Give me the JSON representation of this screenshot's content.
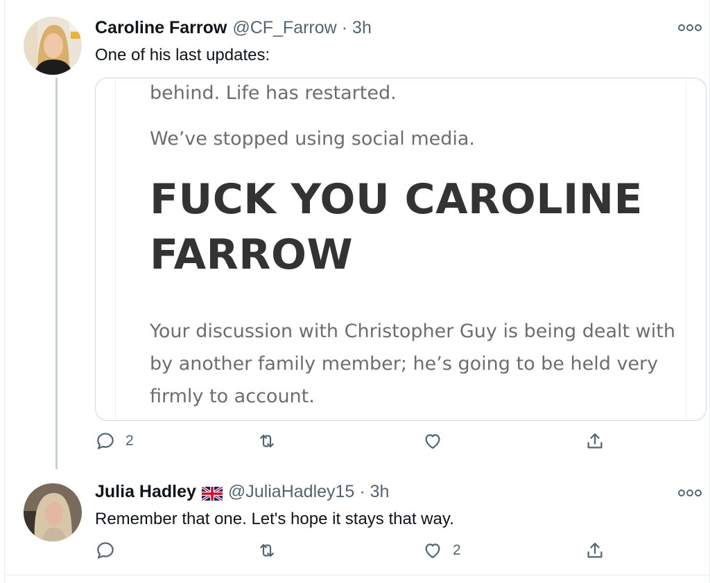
{
  "tweets": [
    {
      "author_name": "Caroline Farrow",
      "handle": "@CF_Farrow",
      "time": "3h",
      "text": "One of his last updates:",
      "media": {
        "line1": "behind. Life has restarted.",
        "line2": "We’ve stopped using social media.",
        "heading_line1": "FUCK YOU CAROLINE",
        "heading_line2": "FARROW",
        "paragraph": "Your discussion with Christopher Guy is being dealt with by another family member; he’s going to be held very firmly to account."
      },
      "reply_count": "2",
      "retweet_count": "",
      "like_count": ""
    },
    {
      "author_name": "Julia Hadley",
      "handle": "@JuliaHadley15",
      "time": "3h",
      "text": "Remember that one. Let's hope it stays that way.",
      "reply_count": "",
      "retweet_count": "",
      "like_count": "2"
    }
  ],
  "separator": "·",
  "icons": {
    "reply": "reply-icon",
    "retweet": "retweet-icon",
    "like": "heart-icon",
    "share": "share-icon",
    "more": "more-options-icon",
    "flag": "uk-flag-icon"
  },
  "colors": {
    "text_primary": "#0f1419",
    "text_secondary": "#536471",
    "border": "#cfd9de",
    "thread_line": "#c4cfd6"
  }
}
